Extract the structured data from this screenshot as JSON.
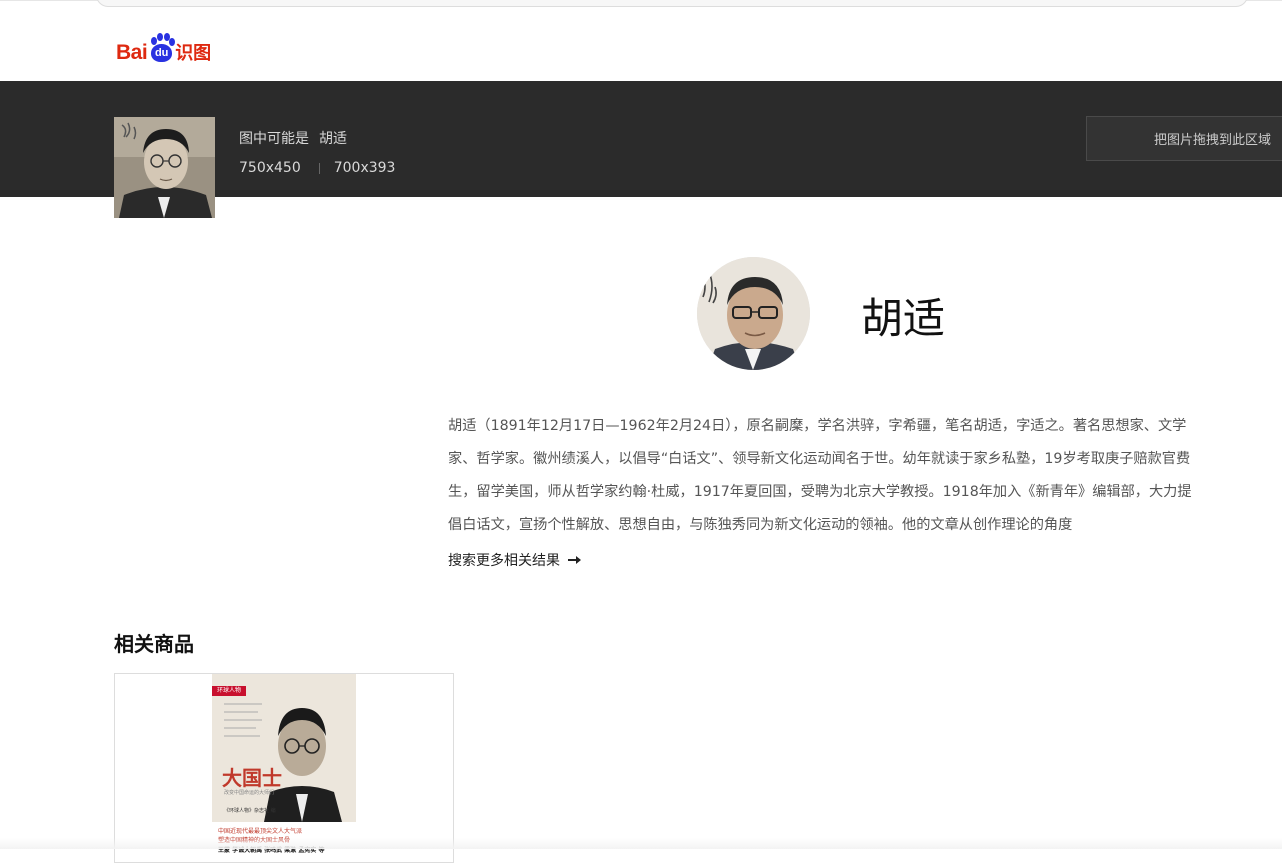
{
  "header": {
    "logo_text_bai": "Bai",
    "logo_paw_text": "du",
    "logo_text_product": "识图"
  },
  "query": {
    "guess_label": "图中可能是",
    "guess_name": "胡适",
    "sizes": [
      "750x450",
      "700x393"
    ],
    "dropzone_label": "把图片拖拽到此区域"
  },
  "entity": {
    "title": "胡适",
    "description": "胡适（1891年12月17日—1962年2月24日），原名嗣穈，学名洪骍，字希疆，笔名胡适，字适之。著名思想家、文学家、哲学家。徽州绩溪人，以倡导“白话文”、领导新文化运动闻名于世。幼年就读于家乡私塾，19岁考取庚子赔款官费生，留学美国，师从哲学家约翰·杜威，1917年夏回国，受聘为北京大学教授。1918年加入《新青年》编辑部，大力提倡白话文，宣扬个性解放、思想自由，与陈独秀同为新文化运动的领袖。他的文章从创作理论的角度",
    "more_link": "搜索更多相关结果"
  },
  "products": {
    "section_title": "相关商品",
    "items": [
      {
        "cover_tag": "环球人物",
        "cover_title": "大国士",
        "cover_subtitle": "改变中国命运的大师们",
        "cover_author": "《环球人物》杂志社 编",
        "cover_line1": "中国近现代最最顶尖文人大气派",
        "cover_line2": "塑造中国精神的大国士风骨",
        "cover_line3": "王蒙 学诚大朝禹 张鸣武 梁漱 孟宪实 等"
      }
    ]
  },
  "colors": {
    "dark_bar": "#2b2b2b",
    "logo_red": "#de2910",
    "logo_blue": "#2932e1"
  }
}
